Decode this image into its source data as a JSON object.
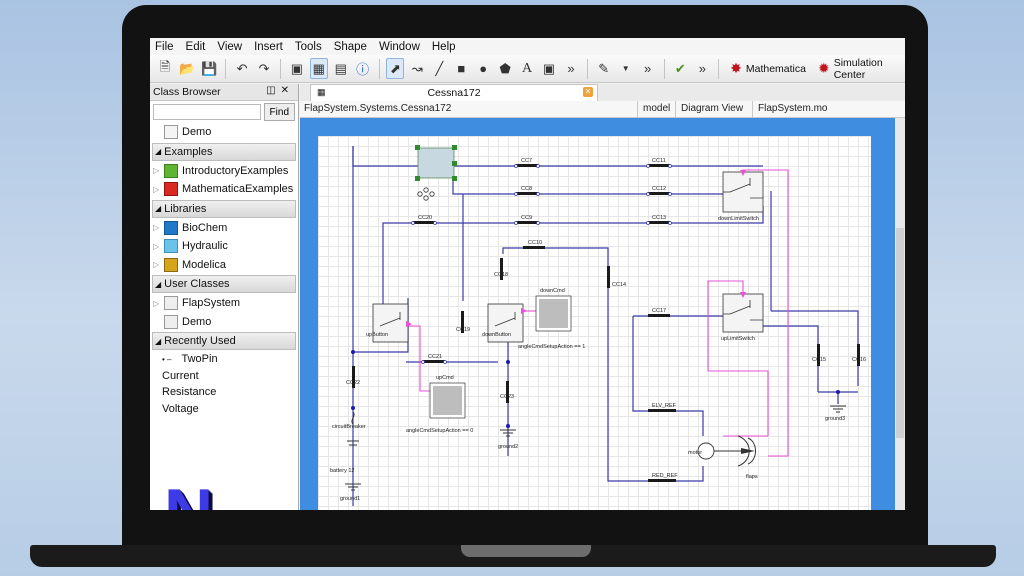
{
  "menu": [
    "File",
    "Edit",
    "View",
    "Insert",
    "Tools",
    "Shape",
    "Window",
    "Help"
  ],
  "toolbar": {
    "mathematica_label": "Mathematica",
    "simulation_center_label": "Simulation Center"
  },
  "class_browser": {
    "title": "Class Browser",
    "find_label": "Find",
    "demo_top": "Demo",
    "sections": {
      "examples": "Examples",
      "libraries": "Libraries",
      "user_classes": "User Classes",
      "recently_used": "Recently Used"
    },
    "examples": [
      "IntroductoryExamples",
      "MathematicaExamples"
    ],
    "libraries": [
      "BioChem",
      "Hydraulic",
      "Modelica"
    ],
    "user_classes": [
      "FlapSystem",
      "Demo"
    ],
    "recent": [
      "TwoPin",
      "Current",
      "Resistance",
      "Voltage"
    ],
    "logo_letter": "N"
  },
  "document": {
    "tab_title": "Cessna172",
    "path": "FlapSystem.Systems.Cessna172",
    "class_type": "model",
    "view": "Diagram View",
    "file": "FlapSystem.mo"
  },
  "diagram": {
    "cc_labels": [
      "CC7",
      "CC11",
      "CC8",
      "CC12",
      "CC20",
      "CC9",
      "CC13",
      "CC10",
      "CC17",
      "CC14",
      "CC19",
      "CC21",
      "CC22",
      "CC15",
      "CC16",
      "CC18",
      "CC23"
    ],
    "switch_labels": [
      "downLimitSwitch",
      "upLimitSwitch",
      "upButton",
      "downButton"
    ],
    "cmd_labels": [
      "upCmd",
      "downCmd",
      "angleCmdSetupAction == 0",
      "angleCmdSetupAction == 1"
    ],
    "other_labels": [
      "circuitBreaker",
      "battery 12",
      "ground1",
      "ground2",
      "ground3",
      "motor",
      "flaps",
      "ELV_REF",
      "RED_REF"
    ],
    "colors": {
      "wire": "#3b3ba8",
      "signal": "#ea4fd6",
      "frame": "#3f8de0"
    }
  }
}
